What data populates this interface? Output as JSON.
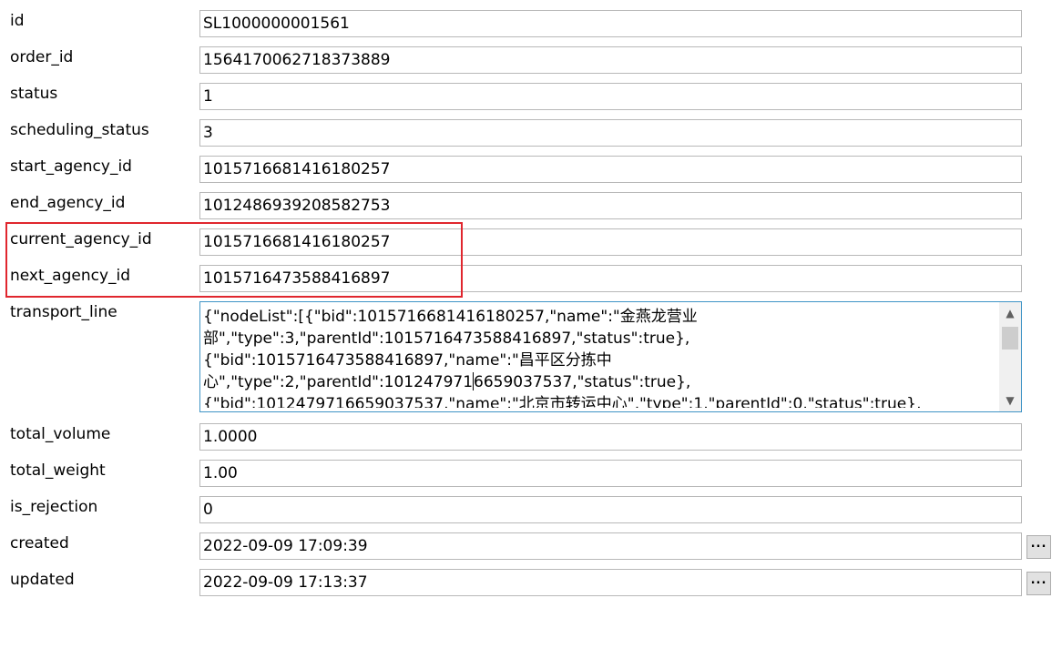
{
  "fields": [
    {
      "label": "id",
      "value": "SL1000000001561"
    },
    {
      "label": "order_id",
      "value": "1564170062718373889"
    },
    {
      "label": "status",
      "value": "1"
    },
    {
      "label": "scheduling_status",
      "value": "3"
    },
    {
      "label": "start_agency_id",
      "value": "1015716681416180257"
    },
    {
      "label": "end_agency_id",
      "value": "1012486939208582753"
    },
    {
      "label": "current_agency_id",
      "value": "1015716681416180257"
    },
    {
      "label": "next_agency_id",
      "value": "1015716473588416897"
    }
  ],
  "transport_line": {
    "label": "transport_line",
    "lines": [
      "{\"nodeList\":[{\"bid\":1015716681416180257,\"name\":\"金燕龙营业",
      "部\",\"type\":3,\"parentId\":1015716473588416897,\"status\":true},",
      "{\"bid\":1015716473588416897,\"name\":\"昌平区分拣中",
      "心\",\"type\":2,\"parentId\":101247971",
      "{\"bid\":1012479716659037537,\"name\":\"北京市转运中心\",\"type\":1,\"parentId\":0,\"status\":true},"
    ],
    "line4_after_caret": "6659037537,\"status\":true},",
    "scroll_up_icon": "▲",
    "scroll_down_icon": "▼"
  },
  "fields_after": [
    {
      "label": "total_volume",
      "value": "1.0000"
    },
    {
      "label": "total_weight",
      "value": "1.00"
    },
    {
      "label": "is_rejection",
      "value": "0"
    },
    {
      "label": "created",
      "value": "2022-09-09 17:09:39",
      "button": "..."
    },
    {
      "label": "updated",
      "value": "2022-09-09 17:13:37",
      "button": "..."
    }
  ],
  "highlight_color": "#e0262e"
}
